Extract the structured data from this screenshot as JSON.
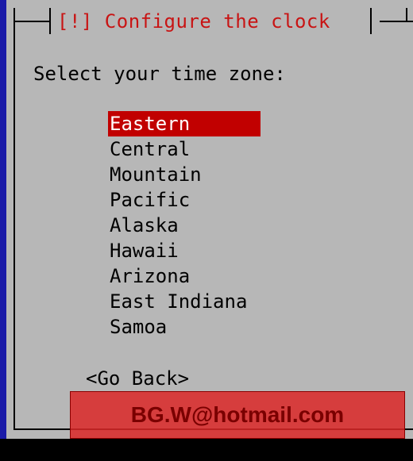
{
  "dialog": {
    "title": "[!] Configure the clock",
    "prompt": "Select your time zone:",
    "zones": [
      {
        "label": "Eastern",
        "selected": true
      },
      {
        "label": "Central",
        "selected": false
      },
      {
        "label": "Mountain",
        "selected": false
      },
      {
        "label": "Pacific",
        "selected": false
      },
      {
        "label": "Alaska",
        "selected": false
      },
      {
        "label": "Hawaii",
        "selected": false
      },
      {
        "label": "Arizona",
        "selected": false
      },
      {
        "label": "East Indiana",
        "selected": false
      },
      {
        "label": "Samoa",
        "selected": false
      }
    ],
    "go_back_label": "<Go Back>"
  },
  "watermark": {
    "text": "BG.W@hotmail.com"
  },
  "colors": {
    "background": "#1a1aa8",
    "dialog": "#b7b7b7",
    "title": "#c81414",
    "selection": "#c10000"
  }
}
